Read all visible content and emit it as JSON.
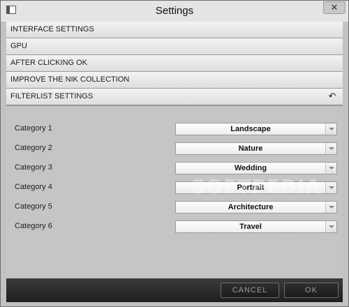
{
  "window": {
    "title": "Settings",
    "close_label": "✕"
  },
  "sections": [
    {
      "label": "INTERFACE SETTINGS"
    },
    {
      "label": "GPU"
    },
    {
      "label": "AFTER CLICKING OK"
    },
    {
      "label": "IMPROVE THE NIK COLLECTION"
    },
    {
      "label": "FILTERLIST SETTINGS",
      "icon": "reset-arrow-icon",
      "icon_glyph": "↶"
    }
  ],
  "categories": [
    {
      "label": "Category 1",
      "value": "Landscape"
    },
    {
      "label": "Category 2",
      "value": "Nature"
    },
    {
      "label": "Category 3",
      "value": "Wedding"
    },
    {
      "label": "Category 4",
      "value": "Portrait"
    },
    {
      "label": "Category 5",
      "value": "Architecture"
    },
    {
      "label": "Category 6",
      "value": "Travel"
    }
  ],
  "footer": {
    "cancel_label": "CANCEL",
    "ok_label": "OK"
  },
  "watermark": "SOFTPEDIA",
  "colors": {
    "footer_bg": "#1f1f1f",
    "panel_bg": "#c5c5c5",
    "header_bg": "#e4e4e4"
  }
}
